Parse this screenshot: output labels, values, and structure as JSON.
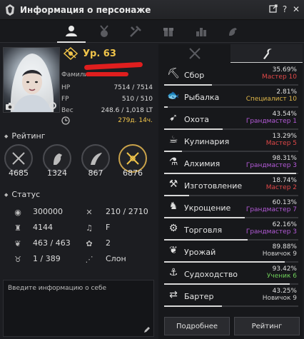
{
  "window": {
    "title": "Информация о персонаже"
  },
  "character": {
    "level": "Ур. 63",
    "family_label": "Фамилия:",
    "hp_label": "HP",
    "hp_value": "7514 / 7514",
    "fp_label": "FP",
    "fp_value": "510 / 510",
    "weight_label": "Вес",
    "weight_value": "248.6 / 1,018 LT",
    "time_value": "279д. 14ч."
  },
  "rating": {
    "title": "Рейтинг",
    "values": [
      "4685",
      "1324",
      "867",
      "6876"
    ]
  },
  "status": {
    "title": "Статус",
    "items": [
      "300000",
      "210 / 2710",
      "4144",
      "F",
      "463 / 463",
      "2",
      "1 / 389",
      "Слон"
    ]
  },
  "about": {
    "placeholder": "Введите информацию о себе"
  },
  "life_skills": [
    {
      "name": "Сбор",
      "percent": "35.69%",
      "rank": "Мастер 10",
      "rank_color": "#e04848",
      "fraction": 0.3569,
      "icon": "gathering-icon"
    },
    {
      "name": "Рыбалка",
      "percent": "2.81%",
      "rank": "Специалист 10",
      "rank_color": "#e0b84a",
      "fraction": 0.0281,
      "icon": "fishing-icon"
    },
    {
      "name": "Охота",
      "percent": "43.54%",
      "rank": "Грандмастер 1",
      "rank_color": "#b45ad8",
      "fraction": 0.4354,
      "icon": "hunting-icon"
    },
    {
      "name": "Кулинария",
      "percent": "13.29%",
      "rank": "Мастер 5",
      "rank_color": "#e04848",
      "fraction": 0.1329,
      "icon": "cooking-icon"
    },
    {
      "name": "Алхимия",
      "percent": "98.31%",
      "rank": "Грандмастер 3",
      "rank_color": "#b45ad8",
      "fraction": 0.9831,
      "icon": "alchemy-icon"
    },
    {
      "name": "Изготовление",
      "percent": "18.74%",
      "rank": "Мастер 2",
      "rank_color": "#e04848",
      "fraction": 0.1874,
      "icon": "processing-icon"
    },
    {
      "name": "Укрощение",
      "percent": "60.13%",
      "rank": "Грандмастер 7",
      "rank_color": "#b45ad8",
      "fraction": 0.6013,
      "icon": "training-icon"
    },
    {
      "name": "Торговля",
      "percent": "62.16%",
      "rank": "Грандмастер 3",
      "rank_color": "#b45ad8",
      "fraction": 0.6216,
      "icon": "trade-icon"
    },
    {
      "name": "Урожай",
      "percent": "89.88%",
      "rank": "Новичок 9",
      "rank_color": "#cfcfcf",
      "fraction": 0.8988,
      "icon": "farming-icon"
    },
    {
      "name": "Судоходство",
      "percent": "93.42%",
      "rank": "Ученик 6",
      "rank_color": "#6fcf5a",
      "fraction": 0.9342,
      "icon": "sailing-icon"
    },
    {
      "name": "Бартер",
      "percent": "43.25%",
      "rank": "Новичок 9",
      "rank_color": "#cfcfcf",
      "fraction": 0.4325,
      "icon": "barter-icon"
    }
  ],
  "buttons": {
    "details": "Подробнее",
    "rating": "Рейтинг"
  }
}
